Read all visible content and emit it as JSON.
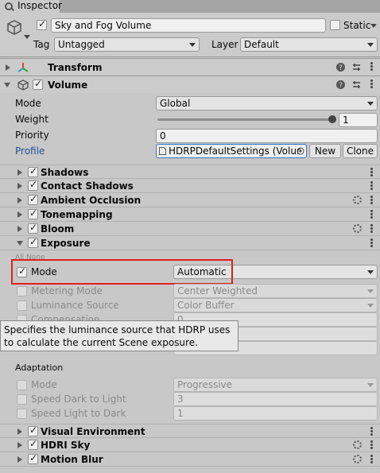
{
  "tab": {
    "label": "Inspector"
  },
  "header": {
    "object_name": "Sky and Fog Volume",
    "static_label": "Static",
    "tag_label": "Tag",
    "tag_value": "Untagged",
    "layer_label": "Layer",
    "layer_value": "Default"
  },
  "components": {
    "transform": "Transform",
    "volume": "Volume"
  },
  "volume": {
    "mode_label": "Mode",
    "mode_value": "Global",
    "weight_label": "Weight",
    "weight_value": "1",
    "weight_level": 1.0,
    "priority_label": "Priority",
    "priority_value": "0",
    "profile_label": "Profile",
    "profile_value": "HDRPDefaultSettings (Volur",
    "new_label": "New",
    "clone_label": "Clone"
  },
  "overrides": {
    "shadows": "Shadows",
    "contact_shadows": "Contact Shadows",
    "ambient_occlusion": "Ambient Occlusion",
    "tonemapping": "Tonemapping",
    "bloom": "Bloom",
    "exposure": "Exposure",
    "visual_environment": "Visual Environment",
    "hdri_sky": "HDRI Sky",
    "motion_blur": "Motion Blur"
  },
  "exposure": {
    "all_none": "All  None",
    "mode_label": "Mode",
    "mode_value": "Automatic",
    "metering_label": "Metering Mode",
    "metering_value": "Center Weighted",
    "luminance_label": "Luminance Source",
    "luminance_value": "Color Buffer",
    "compensation_label": "Compensation",
    "compensation_value": "0",
    "adaptation_header": "Adaptation",
    "adapt_mode_label": "Mode",
    "adapt_mode_value": "Progressive",
    "dark_to_light_label": "Speed Dark to Light",
    "dark_to_light_value": "3",
    "light_to_dark_label": "Speed Light to Dark",
    "light_to_dark_value": "1"
  },
  "tooltip": {
    "text": "Specifies the luminance source that HDRP uses to calculate the current Scene exposure."
  },
  "colors": {
    "highlight": "#e02020",
    "link": "#1f4f9a"
  }
}
